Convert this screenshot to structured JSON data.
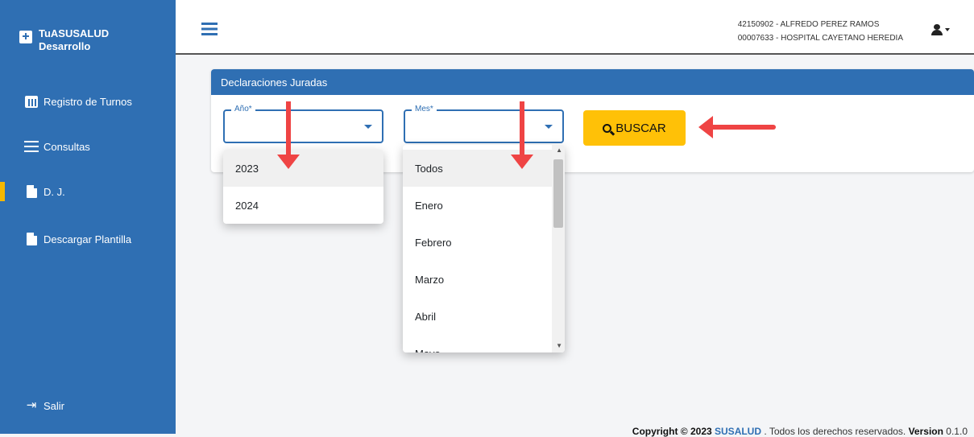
{
  "sidebar": {
    "brand_line1": "TuASUSALUD",
    "brand_line2": "Desarrollo",
    "items": [
      {
        "label": "Registro de Turnos",
        "icon": "calendar-icon"
      },
      {
        "label": "Consultas",
        "icon": "list-icon"
      },
      {
        "label": "D. J.",
        "icon": "pdf-file-icon",
        "active": true
      },
      {
        "label": "Descargar Plantilla",
        "icon": "file-download-icon"
      }
    ],
    "logout_label": "Salir"
  },
  "header": {
    "user_line1": "42150902 - ALFREDO PEREZ RAMOS",
    "user_line2": "00007633 - HOSPITAL CAYETANO HEREDIA"
  },
  "card": {
    "title": "Declaraciones Juradas",
    "year_label": "Año*",
    "month_label": "Mes*",
    "search_label": "BUSCAR"
  },
  "year_options": [
    "2023",
    "2024"
  ],
  "month_options": [
    "Todos",
    "Enero",
    "Febrero",
    "Marzo",
    "Abril",
    "Mayo"
  ],
  "footer": {
    "copyright": "Copyright © 2023",
    "org": "SUSALUD",
    "rights": ". Todos los derechos reservados.",
    "version_label": "Version",
    "version_value": "0.1.0"
  },
  "colors": {
    "primary": "#2f6fb3",
    "accent": "#ffc107",
    "annotation": "#ef4444"
  }
}
